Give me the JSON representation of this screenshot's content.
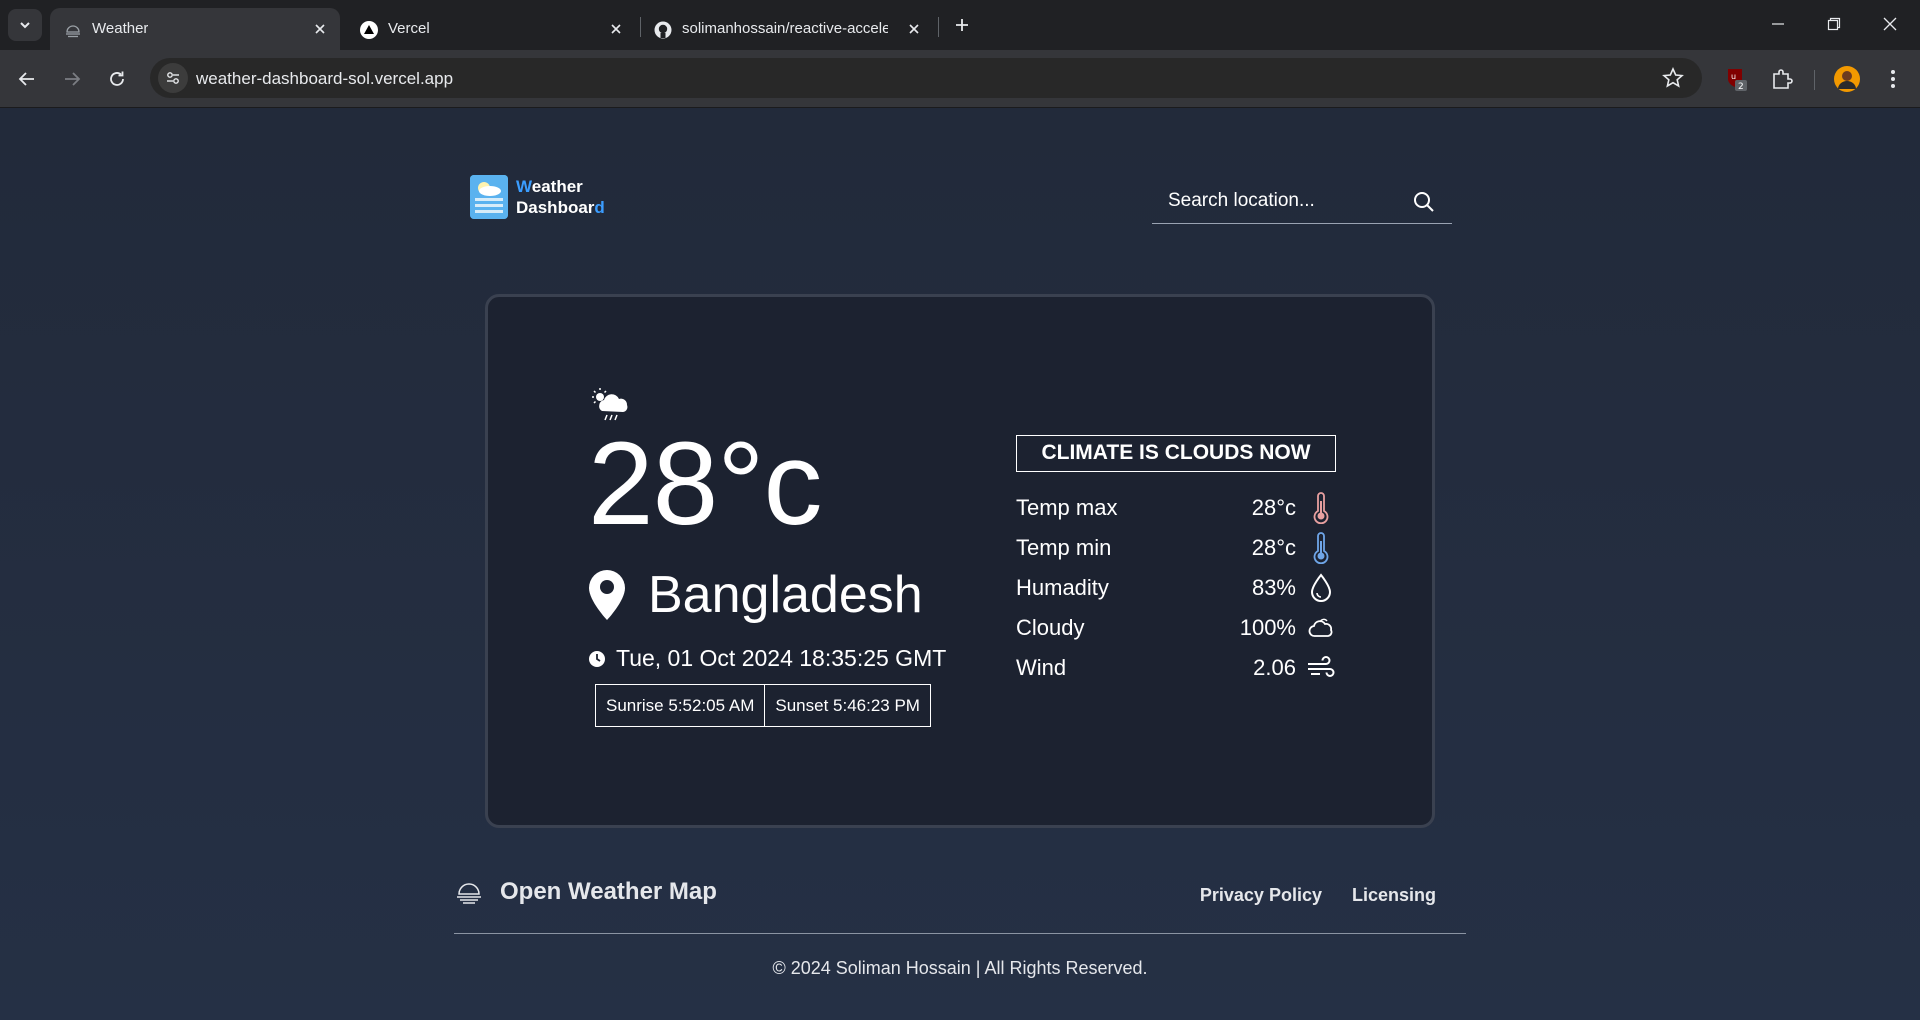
{
  "browser": {
    "tabs": [
      {
        "title": "Weather",
        "active": true
      },
      {
        "title": "Vercel",
        "active": false
      },
      {
        "title": "solimanhossain/reactive-acceler",
        "active": false
      }
    ],
    "url": "weather-dashboard-sol.vercel.app",
    "extension_badge": "2"
  },
  "header": {
    "logo_line1_accent": "W",
    "logo_line1_rest": "eather",
    "logo_line2_rest": "Dashboar",
    "logo_line2_accent": "d",
    "search_placeholder": "Search location..."
  },
  "weather": {
    "icon": "cloud-sun-rain-icon",
    "temperature": "28°c",
    "location": "Bangladesh",
    "datetime": "Tue, 01 Oct 2024 18:35:25 GMT",
    "sunrise": "Sunrise 5:52:05 AM",
    "sunset": "Sunset 5:46:23 PM",
    "climate": "CLIMATE IS CLOUDS NOW",
    "stats": [
      {
        "label": "Temp max",
        "value": "28°c",
        "icon": "thermometer-hot-icon"
      },
      {
        "label": "Temp min",
        "value": "28°c",
        "icon": "thermometer-cold-icon"
      },
      {
        "label": "Humadity",
        "value": "83%",
        "icon": "droplet-icon"
      },
      {
        "label": "Cloudy",
        "value": "100%",
        "icon": "cloud-icon"
      },
      {
        "label": "Wind",
        "value": "2.06",
        "icon": "wind-icon"
      }
    ]
  },
  "footer": {
    "brand": "Open Weather Map",
    "links": [
      "Privacy Policy",
      "Licensing"
    ],
    "copyright": "© 2024 Soliman Hossain | All Rights Reserved."
  },
  "colors": {
    "accent": "#3b9dff",
    "page_bg": "#222a3a",
    "card_bg": "#1c2230",
    "thermo_hot": "#e8a0a0",
    "thermo_cold": "#6fa6e8"
  }
}
